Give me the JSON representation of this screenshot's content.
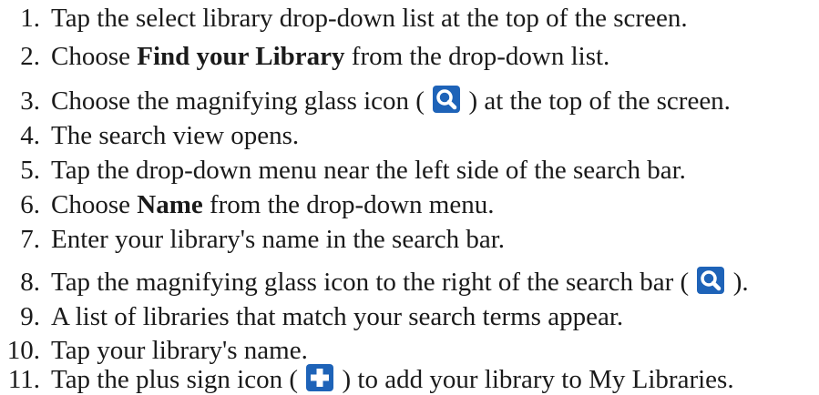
{
  "steps": [
    {
      "num": "1.",
      "parts": [
        "Tap the select library drop-down list at the top of the screen."
      ]
    },
    {
      "num": "2.",
      "pre": "Choose ",
      "bold": "Find your Library",
      "post": " from the drop-down list."
    },
    {
      "num": "3.",
      "pre": "Choose the magnifying glass icon ( ",
      "icon": "magnifying-glass-icon",
      "post": " ) at the top of the screen."
    },
    {
      "num": "4.",
      "parts": [
        "The search view opens."
      ]
    },
    {
      "num": "5.",
      "parts": [
        "Tap the drop-down menu near the left side of the search bar."
      ]
    },
    {
      "num": "6.",
      "pre": "Choose ",
      "bold": "Name",
      "post": " from the drop-down menu."
    },
    {
      "num": "7.",
      "parts": [
        "Enter your library's name in the search bar."
      ]
    },
    {
      "num": "8.",
      "pre": "Tap the magnifying glass icon to the right of the search bar ( ",
      "icon": "magnifying-glass-icon",
      "post": " )."
    },
    {
      "num": "9.",
      "parts": [
        "A list of libraries that match your search terms appear."
      ]
    },
    {
      "num": "10.",
      "parts": [
        "Tap your library's name."
      ]
    },
    {
      "num": "11.",
      "pre": "Tap the plus sign icon ( ",
      "icon": "plus-sign-icon",
      "post": " ) to add your library to My Libraries."
    }
  ],
  "colors": {
    "icon_background": "#1e63b8",
    "icon_glyph": "#ffffff"
  }
}
